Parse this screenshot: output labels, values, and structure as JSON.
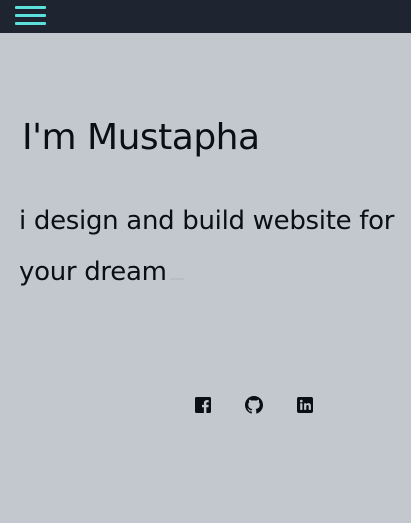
{
  "nav": {
    "menu_icon": "hamburger-menu-icon",
    "menu_color": "#5ce0dc",
    "bar_color": "#1e2430"
  },
  "hero": {
    "title": "I'm Mustapha",
    "tagline": "i design and build website for your dream"
  },
  "social": [
    {
      "name": "facebook",
      "icon": "facebook-icon"
    },
    {
      "name": "github",
      "icon": "github-icon"
    },
    {
      "name": "linkedin",
      "icon": "linkedin-icon"
    }
  ],
  "colors": {
    "background": "#c2c8cd",
    "text": "#0b0f14"
  }
}
